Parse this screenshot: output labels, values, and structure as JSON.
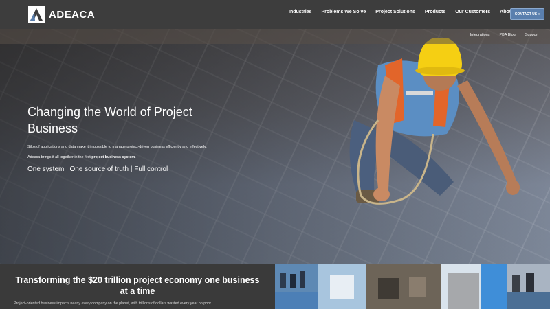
{
  "brand": {
    "name": "ADEACA"
  },
  "nav": {
    "items": [
      "Industries",
      "Problems We Solve",
      "Project Solutions",
      "Products",
      "Our Customers",
      "About Us"
    ],
    "cta": "CONTACT US »"
  },
  "subnav": {
    "items": [
      "Integrations",
      "PBA Blog",
      "Support"
    ]
  },
  "hero": {
    "title": "Changing the World of Project Business",
    "p1": "Silos of applications and data make it impossible to manage project-driven business efficiently and effectively.",
    "p2_prefix": "Adeaca brings it all together in the first ",
    "p2_bold": "project business system",
    "p2_suffix": ".",
    "tagline": "One system | One source of truth | Full control"
  },
  "section": {
    "title": "Transforming the $20 trillion project economy one business at a time",
    "text": "Project-oriented business impacts nearly every company on the planet, with trillions of dollars wasted every year on poor"
  },
  "colors": {
    "accent": "#5a7fae",
    "dark": "#3a3a3a",
    "helmet": "#f5cf13",
    "vest": "#e2652a"
  },
  "icons": [
    "adeaca-logo-icon"
  ]
}
